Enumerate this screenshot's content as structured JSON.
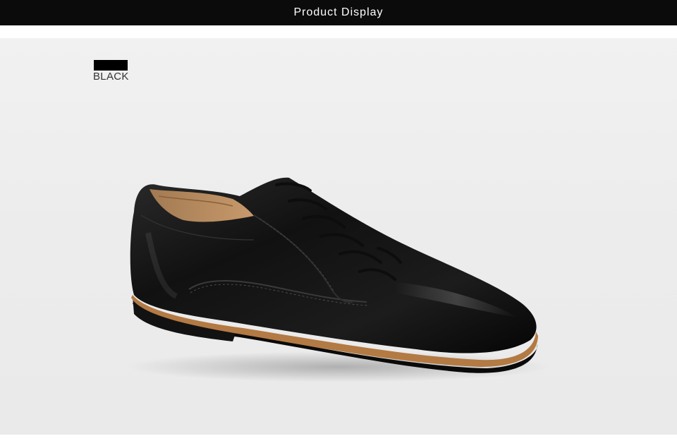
{
  "header": {
    "title": "Product Display"
  },
  "color_option": {
    "label": "BLACK",
    "swatch_color": "#000000"
  },
  "product_image": {
    "icon": "black-leather-oxford-shoe"
  }
}
